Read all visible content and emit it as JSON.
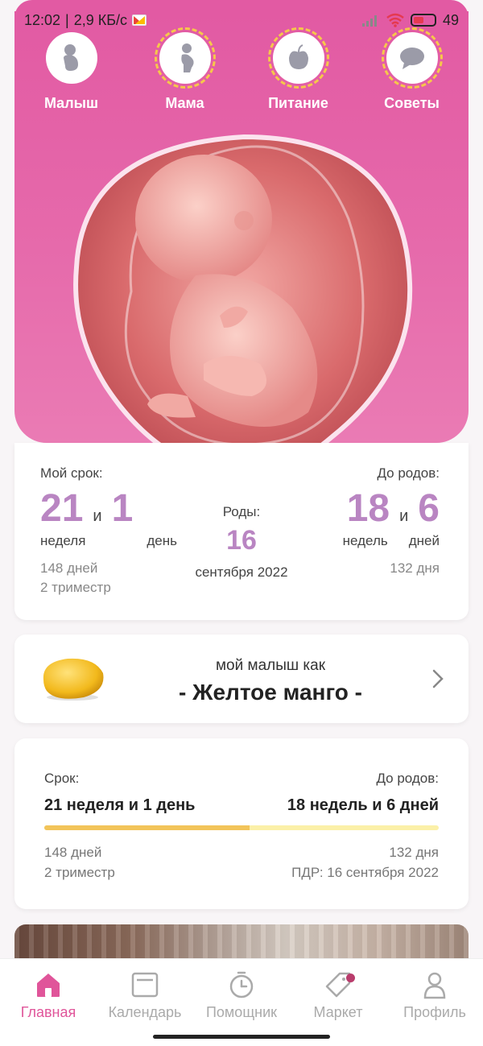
{
  "status_bar": {
    "time": "12:02",
    "network_speed": "2,9 КБ/с",
    "battery": "49"
  },
  "hero_nav": [
    {
      "label": "Малыш",
      "icon": "baby-icon"
    },
    {
      "label": "Мама",
      "icon": "mother-icon"
    },
    {
      "label": "Питание",
      "icon": "apple-icon"
    },
    {
      "label": "Советы",
      "icon": "chat-bubble-icon"
    }
  ],
  "pregnancy": {
    "my_term_label": "Мой срок:",
    "weeks": "21",
    "and": "и",
    "days": "1",
    "weeks_unit": "неделя",
    "days_unit": "день",
    "total_days": "148 дней",
    "trimester": "2 триместр",
    "birth_label": "Роды:",
    "birth_day": "16",
    "birth_month_year": "сентября 2022",
    "until_label": "До родов:",
    "until_weeks": "18",
    "until_days": "6",
    "until_weeks_unit": "недель",
    "until_days_unit": "дней",
    "until_total_days": "132 дня"
  },
  "fruit": {
    "caption": "мой малыш как",
    "name": "- Желтое манго -"
  },
  "progress": {
    "term_label": "Срок:",
    "term_value": "21 неделя и 1 день",
    "until_label": "До родов:",
    "until_value": "18 недель и 6 дней",
    "fraction_complete": 0.52,
    "days": "148 дней",
    "trimester": "2 триместр",
    "remaining_days": "132 дня",
    "due_date": "ПДР: 16 сентября 2022"
  },
  "bottom_nav": [
    {
      "label": "Главная",
      "icon": "home-icon",
      "active": true
    },
    {
      "label": "Календарь",
      "icon": "calendar-icon"
    },
    {
      "label": "Помощник",
      "icon": "timer-icon"
    },
    {
      "label": "Маркет",
      "icon": "tag-icon",
      "badge": true
    },
    {
      "label": "Профиль",
      "icon": "person-icon"
    }
  ],
  "colors": {
    "hero_pink": "#e25aa3",
    "accent_purple": "#b985c2",
    "active_nav": "#e0559a",
    "progress_fill": "#f2c45a",
    "progress_track": "#fbf0a8"
  }
}
